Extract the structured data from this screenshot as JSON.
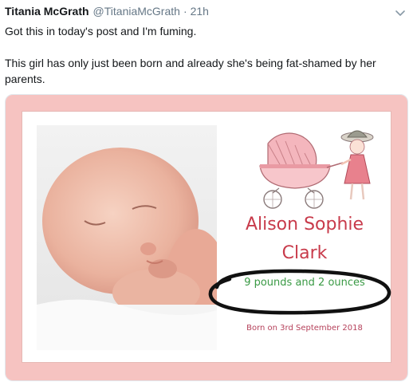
{
  "tweet": {
    "author_name": "Titania McGrath",
    "author_handle": "@TitaniaMcGrath",
    "separator": "·",
    "time": "21h",
    "line1": "Got this in today's post and I'm fuming.",
    "line2": "This girl has only just been born and already she's being fat-shamed by her parents.",
    "menu_icon": "chevron-down-icon"
  },
  "card": {
    "first_name": "Alison Sophie",
    "last_name": "Clark",
    "weight": "9 pounds and 2 ounces",
    "born": "Born on 3rd September 2018",
    "frame_color": "#f6c3c1",
    "name_color": "#c83b4b",
    "weight_color": "#3a9a45",
    "illustration": "pram-and-girl-illustration",
    "photo": "sleeping-newborn-photo"
  }
}
